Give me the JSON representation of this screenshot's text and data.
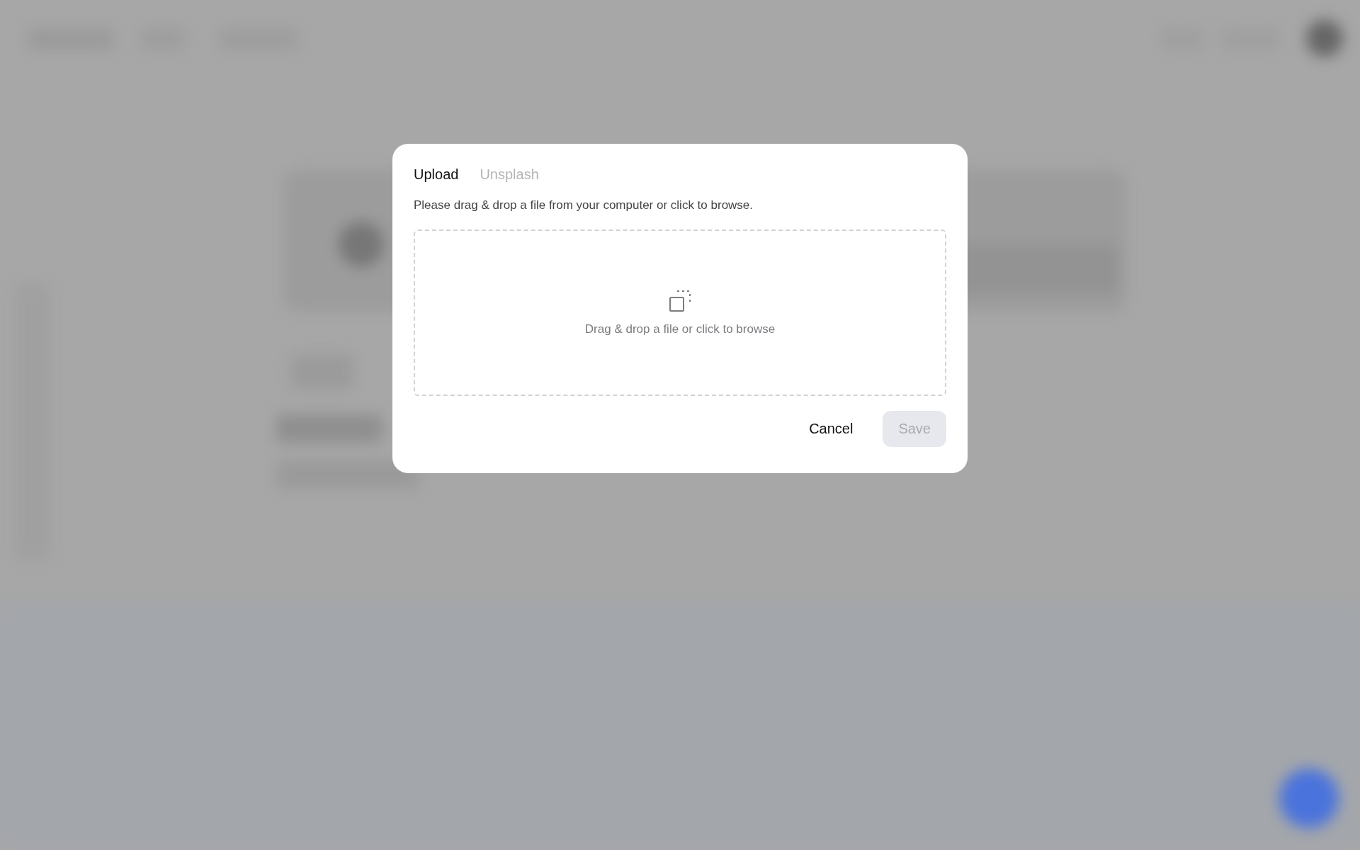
{
  "dialog": {
    "tabs": [
      {
        "label": "Upload",
        "selected": true
      },
      {
        "label": "Unsplash",
        "selected": false
      }
    ],
    "description": "Please drag & drop a file from your computer or click to browse.",
    "dropzone": {
      "label": "Drag & drop a file or click to browse"
    },
    "buttons": [
      {
        "label": "Cancel",
        "kind": "secondary",
        "disabled": false
      },
      {
        "label": "Save",
        "kind": "primary",
        "disabled": true
      }
    ]
  }
}
